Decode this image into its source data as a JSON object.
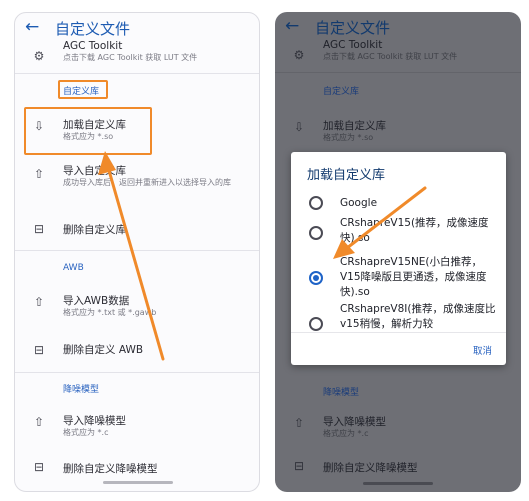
{
  "left_screen": {
    "back_icon": "arrow-left-icon",
    "title": "自定义文件",
    "agc_row": {
      "icon": "settings-cog-icon",
      "title": "AGC Toolkit",
      "subtitle": "点击下载 AGC Toolkit 获取 LUT 文件"
    },
    "section_custom_lib": "自定义库",
    "load_lib": {
      "icon": "file-import-icon",
      "title": "加载自定义库",
      "subtitle": "格式应为 *.so"
    },
    "import_lib": {
      "icon": "upload-icon",
      "title": "导入自定义库",
      "subtitle": "成功导入库后，返回并重新进入以选择导入的库"
    },
    "delete_lib": {
      "icon": "file-delete-icon",
      "title": "删除自定义库"
    },
    "section_awb": "AWB",
    "import_awb": {
      "icon": "upload-icon",
      "title": "导入AWB数据",
      "subtitle": "格式应为 *.txt 或 *.gawb"
    },
    "delete_awb": {
      "icon": "file-delete-icon",
      "title": "删除自定义 AWB"
    },
    "section_denoise": "降噪模型",
    "import_denoise": {
      "icon": "upload-icon",
      "title": "导入降噪模型",
      "subtitle": "格式应为 *.c"
    },
    "delete_denoise": {
      "icon": "file-delete-icon",
      "title": "删除自定义降噪模型"
    }
  },
  "right_screen": {
    "back_icon": "arrow-left-icon",
    "title": "自定义文件",
    "agc_row": {
      "icon": "settings-cog-icon",
      "title": "AGC Toolkit",
      "subtitle": "点击下载 AGC Toolkit 获取 LUT 文件"
    },
    "section_custom_lib": "自定义库",
    "load_lib": {
      "icon": "file-import-icon",
      "title": "加载自定义库",
      "subtitle": "格式应为 *.so"
    },
    "section_denoise": "降噪模型",
    "import_denoise": {
      "icon": "upload-icon",
      "title": "导入降噪模型",
      "subtitle": "格式应为 *.c"
    },
    "delete_denoise": {
      "icon": "file-delete-icon",
      "title": "删除自定义降噪模型"
    }
  },
  "dialog": {
    "title": "加载自定义库",
    "options": [
      {
        "label": "Google",
        "selected": false
      },
      {
        "label": "CRshapreV15(推荐，成像速度快).so",
        "selected": false
      },
      {
        "label": "CRshapreV15NE(小白推荐，V15降噪版且更通透，成像速度快).so",
        "selected": true
      },
      {
        "label": "CRshapreV8I(推荐，成像速度比v15稍慢，解析力较",
        "selected": false
      }
    ],
    "cancel": "取消"
  },
  "colors": {
    "accent": "#1d5bb2",
    "highlight": "#f08a2a",
    "dim_overlay": "#6e6f75"
  }
}
